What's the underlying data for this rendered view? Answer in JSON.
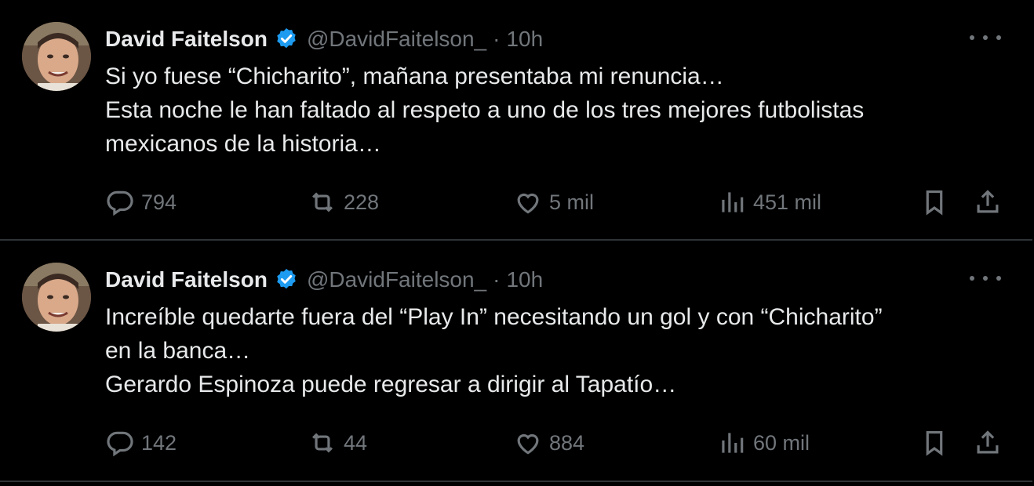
{
  "tweets": [
    {
      "author": {
        "name": "David Faitelson",
        "handle": "@DavidFaitelson_",
        "separator": "·",
        "time": "10h"
      },
      "lines": [
        "Si yo fuese “Chicharito”, mañana presentaba mi renuncia…",
        "Esta noche le han faltado al respeto a uno de los tres mejores futbolistas",
        "mexicanos de la historia…"
      ],
      "stats": {
        "replies": "794",
        "retweets": "228",
        "likes": "5 mil",
        "views": "451 mil"
      }
    },
    {
      "author": {
        "name": "David Faitelson",
        "handle": "@DavidFaitelson_",
        "separator": "·",
        "time": "10h"
      },
      "lines": [
        "Increíble quedarte fuera del “Play In” necesitando un gol y con “Chicharito”",
        "en la banca…",
        "Gerardo Espinoza puede regresar a dirigir al Tapatío…"
      ],
      "stats": {
        "replies": "142",
        "retweets": "44",
        "likes": "884",
        "views": "60 mil"
      }
    }
  ],
  "icons": {
    "more": "more-horizontal-icon",
    "verified": "verified-badge-icon",
    "reply": "reply-icon",
    "retweet": "retweet-icon",
    "like": "heart-icon",
    "views": "views-bar-chart-icon",
    "bookmark": "bookmark-icon",
    "share": "share-icon"
  },
  "colors": {
    "background": "#000000",
    "text": "#e7e9ea",
    "muted": "#71767b",
    "verified": "#1d9bf0",
    "divider": "#2f3336"
  }
}
